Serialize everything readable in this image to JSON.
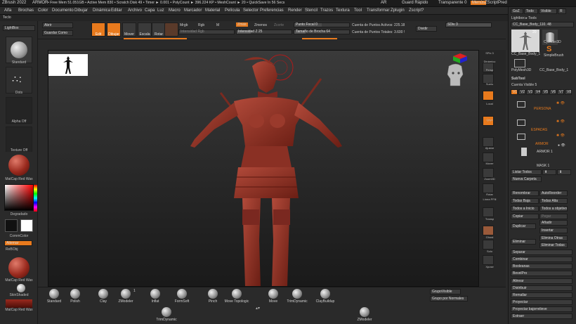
{
  "title_bar": {
    "app": "ZBrush 2022",
    "doc": "ARMOR",
    "stats": "• Free Mem 51.051GB • Active Mem 830 • Scratch Disk 49 • Timer ► 0.001 • PolyCount ► 396.224 KP • MeshCount ► 20 • QuickSave In 56 Secs",
    "ar": "AR",
    "quicksave": "Guard Rápido",
    "transparency": "Transparente 0",
    "menu_btn": "Menús",
    "zscript": "ZScriptPred"
  },
  "menus": [
    "Alfa",
    "Brochas",
    "Color",
    "Documento",
    "Dibujar",
    "Dinámica",
    "Editar",
    "Archivo",
    "Capa",
    "Luz",
    "Macro",
    "Marcador",
    "Material",
    "Película",
    "Selector",
    "Preferencias",
    "Render",
    "Stencil",
    "Trazos",
    "Textura",
    "Tool",
    "Transformar",
    "Zplugin",
    "Zscript",
    "?"
  ],
  "menu_extra": "Teclo",
  "left_shelf": {
    "lightbox": "LightBox",
    "brush_label": "Standard",
    "stroke_label": "Dots",
    "alpha_label": "Alpha Off",
    "texture_label": "Texture Off",
    "material_label": "MatCap Red Wax",
    "gradient_label": "Degradado",
    "switch_color": "CommColor",
    "alternate": "Alternar",
    "repo": "ReBObj",
    "mat2_label": "MatCap Red Wax",
    "skin_label": "SkinShaded",
    "mat3_label": "MatCap Red Wax"
  },
  "toolbar": {
    "open": "Abrir",
    "save_as": "Guardar Como",
    "edit": "Edit",
    "draw": "Dibujar",
    "move": "Mover",
    "scale": "Escala",
    "rotate": "Rotar",
    "mrgb": "Mrgb",
    "rgb": "Rgb",
    "m": "M",
    "rgb_intensity": "Intensidad Rgb",
    "zadd": "Zmas",
    "zsub": "Zmenos",
    "zcut": "Zcorte",
    "z_intensity": "Intensidad Z 25",
    "focal_shift": "Punto Focal 0",
    "draw_size": "Tamaño de Brocha 64",
    "active_points": "Cuenta de Puntos Activos: 225.18",
    "total_points": "Cuenta de Puntos Totales: 3.600 !",
    "divide": "Dividir",
    "sdiv": "SDiv 3"
  },
  "right_strip": {
    "spix": "SPix 3",
    "dynamic": "Dinámico",
    "persp": "Persp",
    "floor": "Suelo",
    "local": "Local",
    "xyz": "Qxyz",
    "frame": "Ajustar",
    "move": "Mover",
    "zoom": "Zoom3D",
    "rotate": "Rotar",
    "linefill": "Línea PFill",
    "transp": "Transp",
    "ghost": "Ghost",
    "solo": "Solo",
    "xpose": "Xpose"
  },
  "right_panel": {
    "goz": "GoZ",
    "all": "Todo",
    "visible": "Visible",
    "r": "R",
    "lightbox_tools": "Lightbox ▸ Tools",
    "current_tool": "CC_Base_Body_110. 48",
    "tool_count": "20",
    "tool1": "CC_Base_Body_1",
    "tool2": "Cylinder3D",
    "tool3": "SimpleBrush",
    "tool4": "PolyMesh3D",
    "tool5": "CC_Base_Body_1",
    "subtool_header": "SubTool",
    "visible_count": "Cuenta Visible 5",
    "tabs": [
      "V1",
      "V2",
      "V3",
      "V4",
      "V5",
      "V6",
      "V7",
      "V8"
    ],
    "layers": [
      "PERSONA",
      "ESPADAS",
      "ARMOR",
      "ARMOR 1",
      "MASK 1"
    ],
    "list_all": "Listar Todos",
    "new_folder": "Nueva Carpeta",
    "rename": "Renombrar",
    "auto_reorder": "AutoReorder",
    "all_low": "Todas Baja",
    "all_high": "Todas Alta",
    "all_to_start": "Todos a Inicio",
    "all_selected": "Todos a objetivo",
    "copy": "Copiar",
    "paste": "Pegar",
    "duplicate": "Duplicar",
    "append": "Añadir",
    "insert": "Insertar",
    "delete": "Eliminar",
    "delete_others": "Elimina Otras",
    "delete_all": "Eliminar Todas",
    "split": "Separar",
    "merge": "Combinar",
    "boolean": "Booleanas",
    "bevelpro": "BevelPro",
    "align": "Alinear",
    "distribute": "Distribuir",
    "remesh": "Remallar",
    "project": "Proyectar",
    "project_bas": "Proyectar bajorrelieve",
    "extract": "Extraer"
  },
  "bottom_shelf": {
    "brushes": [
      "Standard",
      "Polish",
      "Clay",
      "ZModeler",
      "Inflat",
      "FormSoft",
      "Pinch",
      "Move Topologic",
      "Move",
      "TrimDynamic",
      "ClayBuildup"
    ],
    "second_row": [
      "TrimDynamic",
      "ZModeler"
    ],
    "zmodeler_badge": "1",
    "group_visible": "GrupoVisible",
    "groups_by_normals": "Grupo por Normales"
  }
}
